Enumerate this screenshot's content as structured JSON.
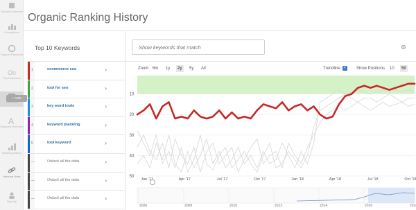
{
  "rail": {
    "items": [
      {
        "label": "Domain Overview",
        "icon": "domain-overview-icon"
      },
      {
        "label": "Competitors",
        "icon": "competitors-icon"
      },
      {
        "label": "Organic Keywords",
        "icon": "organic-keywords-icon"
      },
      {
        "label": "Top Keywords",
        "icon": "top-keywords-icon"
      },
      {
        "label": "Adwords",
        "icon": "adwords-icon"
      },
      {
        "label": "Keyword Overview",
        "icon": "keyword-overview-icon"
      },
      {
        "label": "Ranking History",
        "icon": "ranking-history-icon"
      },
      {
        "label": "Inbound Links",
        "icon": "inbound-links-icon"
      },
      {
        "label": "Sign Up",
        "icon": "sign-up-icon"
      }
    ],
    "add_label": "+ ADD"
  },
  "page_title": "Organic Ranking History",
  "keywords_panel": {
    "header": "Top 10 Keywords",
    "rows": [
      {
        "num": "1",
        "label": "ecommerce seo",
        "locked": false,
        "color": "#c62828"
      },
      {
        "num": "2",
        "label": "tool for seo",
        "locked": false,
        "color": "#43a047"
      },
      {
        "num": "3",
        "label": "key word tools",
        "locked": false,
        "color": "#1e88e5"
      },
      {
        "num": "4",
        "label": "keyword planning",
        "locked": false,
        "color": "#8e24aa"
      },
      {
        "num": "5",
        "label": "tool keyword",
        "locked": false,
        "color": "#1565c0"
      },
      {
        "num": "—",
        "label": "Unlock all the data",
        "locked": true,
        "color": "#444444"
      },
      {
        "num": "—",
        "label": "Unlock all the data",
        "locked": true,
        "color": "#444444"
      },
      {
        "num": "—",
        "label": "Unlock all the data",
        "locked": true,
        "color": "#444444"
      }
    ]
  },
  "search": {
    "placeholder": "Show keywords that match"
  },
  "chart_controls": {
    "zoom_label": "Zoom",
    "zoom_options": [
      "6m",
      "1y",
      "2y",
      "5y",
      "All"
    ],
    "zoom_selected": "2y",
    "trendline_label": "Trendline",
    "trendline_checked": true,
    "positions_label": "Show Positions",
    "position_options": [
      "10",
      "50"
    ],
    "position_selected": "50"
  },
  "chart_data": {
    "type": "line",
    "x": [
      "Jan '17",
      "Apr '17",
      "Jul '17",
      "Oct '17",
      "Jan '18",
      "Apr '18",
      "Jul '18",
      "Oct '18"
    ],
    "y_ticks": [
      "10",
      "20",
      "30",
      "40",
      "50"
    ],
    "ylim": [
      0,
      50
    ],
    "y_reversed": true,
    "highlight_band": [
      1,
      10
    ],
    "series": [
      {
        "color": "#c62828",
        "values": [
          20,
          18,
          15,
          22,
          16,
          14,
          22,
          21,
          22,
          18,
          21,
          22,
          21,
          18,
          22,
          19,
          22,
          21,
          22,
          18,
          15,
          16,
          17,
          14,
          18,
          16,
          15,
          18,
          16,
          20,
          22,
          21,
          15,
          11,
          10,
          7,
          6,
          7,
          6,
          7,
          8,
          7,
          6,
          5,
          5
        ]
      }
    ],
    "navigator_labels": [
      "2006",
      "2008",
      "2010",
      "2012",
      "2014",
      "2016",
      "2018"
    ]
  },
  "colors": {
    "accent": "#c62828",
    "band": "#d4f2c6",
    "checkbox": "#3a7bd5"
  }
}
